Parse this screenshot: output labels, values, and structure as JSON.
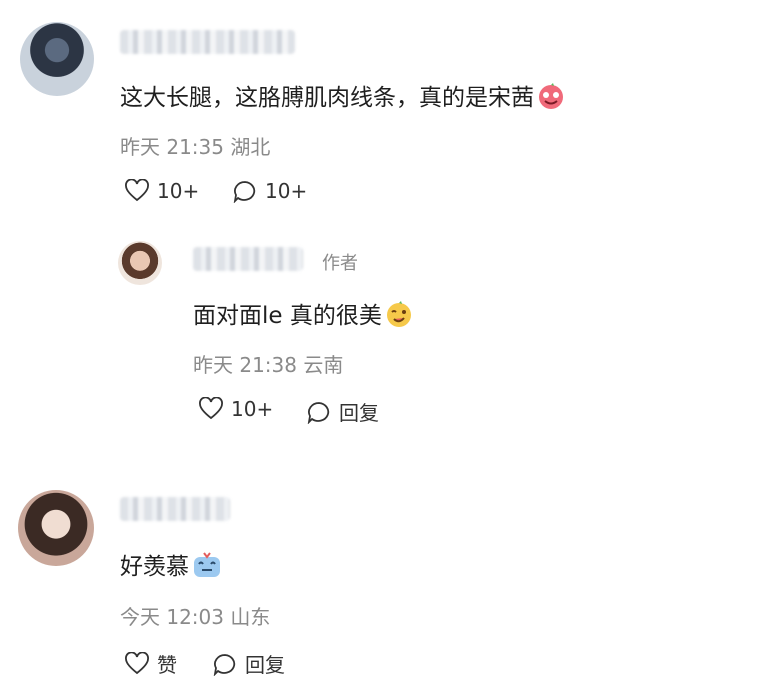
{
  "comments": [
    {
      "text": "这大长腿，这胳膊肌肉线条，真的是宋茜",
      "time": "昨天 21:35",
      "location": "湖北",
      "likes": "10+",
      "replies": "10+",
      "emoji": "smiling-heart-emoji",
      "reply": {
        "author_tag": "作者",
        "text": "面对面le 真的很美",
        "time": "昨天 21:38",
        "location": "云南",
        "likes": "10+",
        "reply_label": "回复",
        "emoji": "wink-emoji"
      }
    },
    {
      "text": "好羡慕",
      "time": "今天 12:03",
      "location": "山东",
      "like_label": "赞",
      "reply_label": "回复",
      "emoji": "drooling-emoji"
    }
  ],
  "colors": {
    "meta": "#8a8a8a",
    "text": "#1f1f1f",
    "icon": "#333333"
  }
}
